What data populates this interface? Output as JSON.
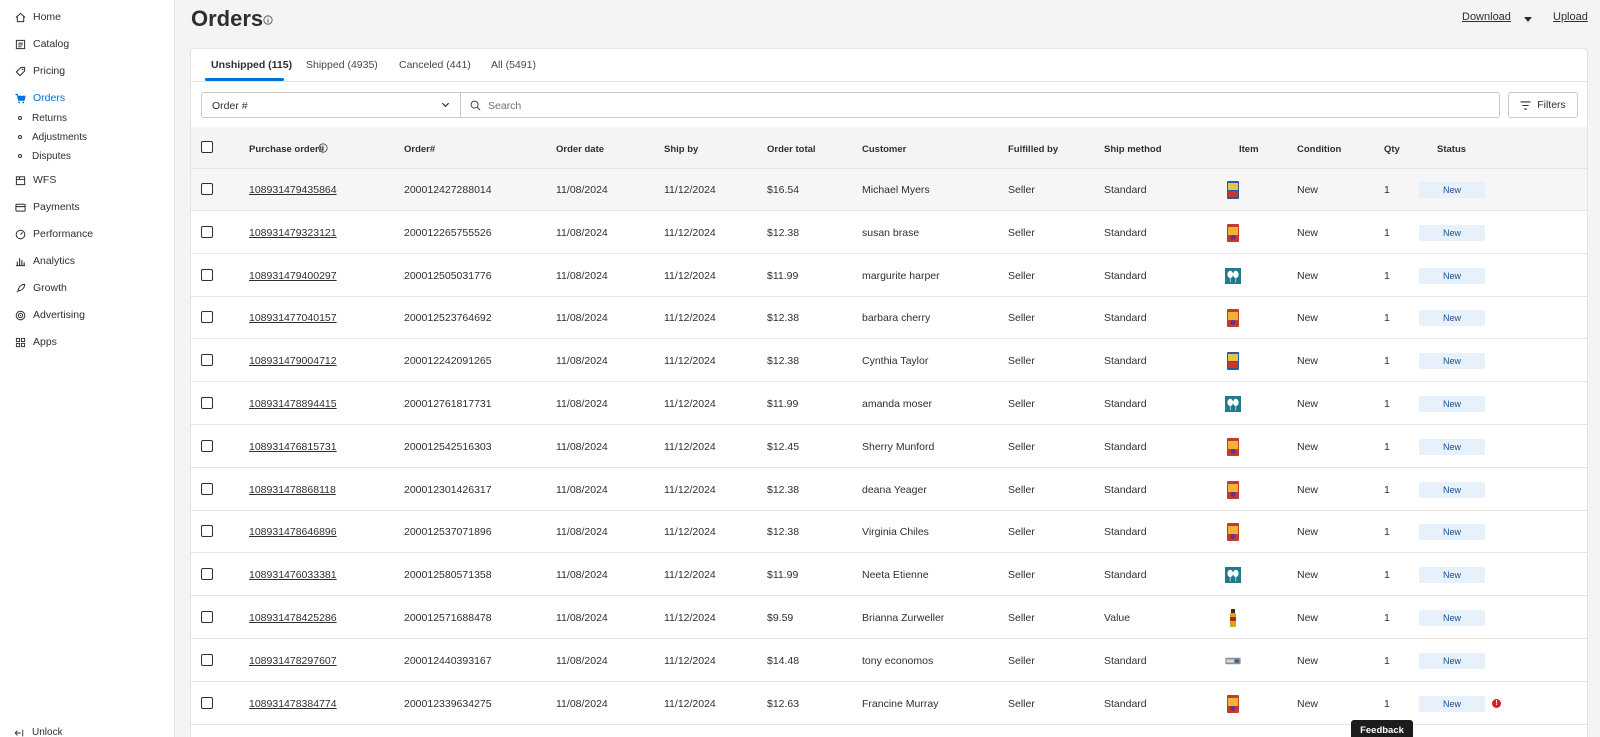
{
  "sidebar": {
    "items": [
      {
        "label": "Home",
        "icon": "home-icon"
      },
      {
        "label": "Catalog",
        "icon": "catalog-icon"
      },
      {
        "label": "Pricing",
        "icon": "tag-icon"
      },
      {
        "label": "Orders",
        "icon": "cart-icon"
      },
      {
        "label": "WFS",
        "icon": "box-icon"
      },
      {
        "label": "Payments",
        "icon": "card-icon"
      },
      {
        "label": "Performance",
        "icon": "gauge-icon"
      },
      {
        "label": "Analytics",
        "icon": "bar-chart-icon"
      },
      {
        "label": "Growth",
        "icon": "rocket-icon"
      },
      {
        "label": "Advertising",
        "icon": "target-icon"
      },
      {
        "label": "Apps",
        "icon": "grid-icon"
      }
    ],
    "sub_items": [
      "Returns",
      "Adjustments",
      "Disputes"
    ],
    "unlock_label": "Unlock"
  },
  "header": {
    "title": "Orders",
    "download_label": "Download",
    "upload_label": "Upload"
  },
  "tabs": [
    "Unshipped (115)",
    "Shipped (4935)",
    "Canceled (441)",
    "All (5491)"
  ],
  "filter_select": "Order #",
  "search": {
    "placeholder": "Search",
    "value": ""
  },
  "filters_label": "Filters",
  "columns": [
    "Purchase order#",
    "Order#",
    "Order date",
    "Ship by",
    "Order total",
    "Customer",
    "Fulfilled by",
    "Ship method",
    "Item",
    "Condition",
    "Qty",
    "Status"
  ],
  "rows": [
    {
      "po": "108931479435864",
      "order": "200012427288014",
      "order_date": "11/08/2024",
      "ship_by": "11/12/2024",
      "total": "$16.54",
      "customer": "Michael Myers",
      "fulfilled": "Seller",
      "method": "Standard",
      "item": "book-box-icon",
      "condition": "New",
      "qty": "1",
      "status": "New"
    },
    {
      "po": "108931479323121",
      "order": "200012265755526",
      "order_date": "11/08/2024",
      "ship_by": "11/12/2024",
      "total": "$12.38",
      "customer": "susan brase",
      "fulfilled": "Seller",
      "method": "Standard",
      "item": "candy-box-icon",
      "condition": "New",
      "qty": "1",
      "status": "New"
    },
    {
      "po": "108931479400297",
      "order": "200012505031776",
      "order_date": "11/08/2024",
      "ship_by": "11/12/2024",
      "total": "$11.99",
      "customer": "margurite harper",
      "fulfilled": "Seller",
      "method": "Standard",
      "item": "balloon-pack-icon",
      "condition": "New",
      "qty": "1",
      "status": "New"
    },
    {
      "po": "108931477040157",
      "order": "200012523764692",
      "order_date": "11/08/2024",
      "ship_by": "11/12/2024",
      "total": "$12.38",
      "customer": "barbara cherry",
      "fulfilled": "Seller",
      "method": "Standard",
      "item": "candy-box-icon",
      "condition": "New",
      "qty": "1",
      "status": "New"
    },
    {
      "po": "108931479004712",
      "order": "200012242091265",
      "order_date": "11/08/2024",
      "ship_by": "11/12/2024",
      "total": "$12.38",
      "customer": "Cynthia Taylor",
      "fulfilled": "Seller",
      "method": "Standard",
      "item": "book-box-icon",
      "condition": "New",
      "qty": "1",
      "status": "New"
    },
    {
      "po": "108931478894415",
      "order": "200012761817731",
      "order_date": "11/08/2024",
      "ship_by": "11/12/2024",
      "total": "$11.99",
      "customer": "amanda moser",
      "fulfilled": "Seller",
      "method": "Standard",
      "item": "balloon-pack-icon",
      "condition": "New",
      "qty": "1",
      "status": "New"
    },
    {
      "po": "108931476815731",
      "order": "200012542516303",
      "order_date": "11/08/2024",
      "ship_by": "11/12/2024",
      "total": "$12.45",
      "customer": "Sherry Munford",
      "fulfilled": "Seller",
      "method": "Standard",
      "item": "candy-box-icon",
      "condition": "New",
      "qty": "1",
      "status": "New"
    },
    {
      "po": "108931478868118",
      "order": "200012301426317",
      "order_date": "11/08/2024",
      "ship_by": "11/12/2024",
      "total": "$12.38",
      "customer": "deana Yeager",
      "fulfilled": "Seller",
      "method": "Standard",
      "item": "candy-box-icon",
      "condition": "New",
      "qty": "1",
      "status": "New"
    },
    {
      "po": "108931478646896",
      "order": "200012537071896",
      "order_date": "11/08/2024",
      "ship_by": "11/12/2024",
      "total": "$12.38",
      "customer": "Virginia Chiles",
      "fulfilled": "Seller",
      "method": "Standard",
      "item": "candy-box-icon",
      "condition": "New",
      "qty": "1",
      "status": "New"
    },
    {
      "po": "108931476033381",
      "order": "200012580571358",
      "order_date": "11/08/2024",
      "ship_by": "11/12/2024",
      "total": "$11.99",
      "customer": "Neeta Etienne",
      "fulfilled": "Seller",
      "method": "Standard",
      "item": "balloon-pack-icon",
      "condition": "New",
      "qty": "1",
      "status": "New"
    },
    {
      "po": "108931478425286",
      "order": "200012571688478",
      "order_date": "11/08/2024",
      "ship_by": "11/12/2024",
      "total": "$9.59",
      "customer": "Brianna Zurweller",
      "fulfilled": "Seller",
      "method": "Value",
      "item": "bottle-icon",
      "condition": "New",
      "qty": "1",
      "status": "New"
    },
    {
      "po": "108931478297607",
      "order": "200012440393167",
      "order_date": "11/08/2024",
      "ship_by": "11/12/2024",
      "total": "$14.48",
      "customer": "tony economos",
      "fulfilled": "Seller",
      "method": "Standard",
      "item": "cable-pack-icon",
      "condition": "New",
      "qty": "1",
      "status": "New"
    },
    {
      "po": "108931478384774",
      "order": "200012339634275",
      "order_date": "11/08/2024",
      "ship_by": "11/12/2024",
      "total": "$12.63",
      "customer": "Francine Murray",
      "fulfilled": "Seller",
      "method": "Standard",
      "item": "candy-box-icon",
      "condition": "New",
      "qty": "1",
      "status": "New",
      "alert": "!"
    }
  ],
  "feedback_label": "Feedback",
  "colors": {
    "accent": "#0071dc",
    "badge_bg": "#e6f1fc",
    "alert": "#de1c24"
  }
}
